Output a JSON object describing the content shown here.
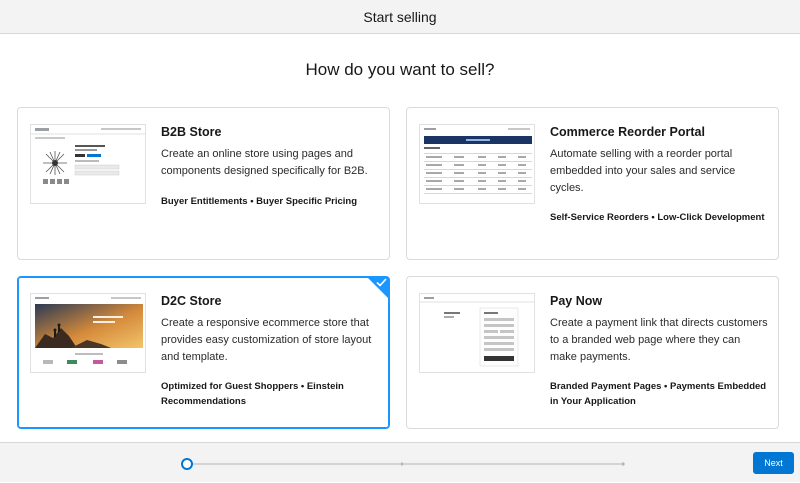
{
  "header": {
    "title": "Start selling"
  },
  "question": "How do you want to sell?",
  "cards": [
    {
      "title": "B2B Store",
      "description": "Create an online store using pages and components designed specifically for B2B.",
      "tags": "Buyer Entitlements • Buyer Specific Pricing",
      "selected": false
    },
    {
      "title": "Commerce Reorder Portal",
      "description": "Automate selling with a reorder portal embedded into your sales and service cycles.",
      "tags": "Self-Service Reorders • Low-Click Development",
      "selected": false
    },
    {
      "title": "D2C Store",
      "description": "Create a responsive ecommerce store that provides easy customization of store layout and template.",
      "tags": "Optimized for Guest Shoppers • Einstein Recommendations",
      "selected": true
    },
    {
      "title": "Pay Now",
      "description": "Create a payment link that directs customers to a branded web page where they can make payments.",
      "tags": "Branded Payment Pages • Payments Embedded in Your Application",
      "selected": false
    }
  ],
  "footer": {
    "next_label": "Next",
    "progress": {
      "current_step": 1,
      "total_steps": 3
    }
  },
  "colors": {
    "accent": "#1b96ff",
    "button": "#0176d3",
    "header_bg": "#f3f3f3"
  },
  "icons": {
    "selected_marker": "checkmark-icon",
    "progress_marker": "progress-step-icon"
  }
}
